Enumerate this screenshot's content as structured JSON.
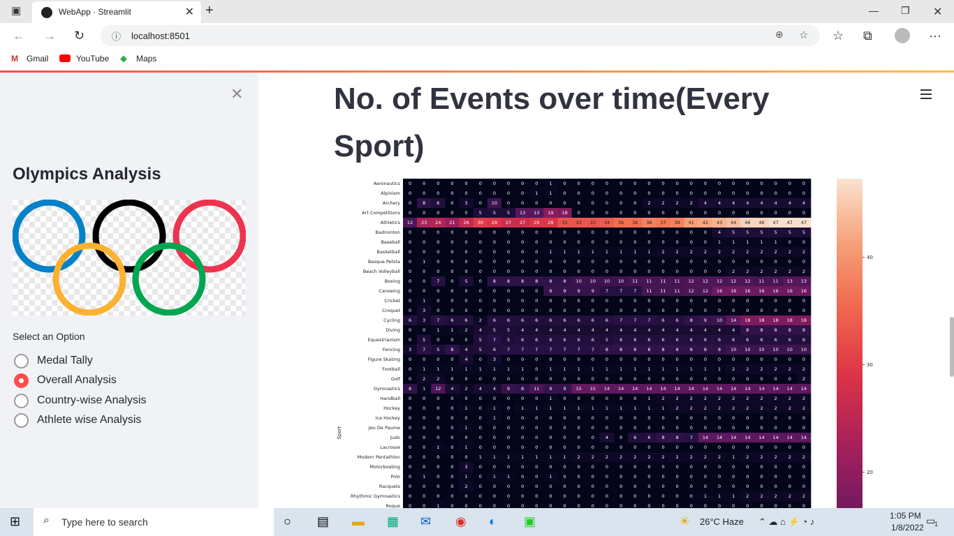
{
  "browser": {
    "tab_title": "WebApp · Streamlit",
    "url": "localhost:8501",
    "bookmarks": [
      "Gmail",
      "YouTube",
      "Maps"
    ]
  },
  "sidebar": {
    "title": "Olympics Analysis",
    "select_label": "Select an Option",
    "options": [
      "Medal Tally",
      "Overall Analysis",
      "Country-wise Analysis",
      "Athlete wise Analysis"
    ],
    "selected": 1
  },
  "main": {
    "title": "No. of Events over time(Every Sport)"
  },
  "chart_data": {
    "type": "heatmap",
    "ylabel": "Sport",
    "colorbar_ticks": [
      20,
      30,
      40
    ],
    "rows": [
      "Aeronautics",
      "Alpinism",
      "Archery",
      "Art Competitions",
      "Athletics",
      "Badminton",
      "Baseball",
      "Basketball",
      "Basque Pelota",
      "Beach Volleyball",
      "Boxing",
      "Canoeing",
      "Cricket",
      "Croquet",
      "Cycling",
      "Diving",
      "Equestrianism",
      "Fencing",
      "Figure Skating",
      "Football",
      "Golf",
      "Gymnastics",
      "Handball",
      "Hockey",
      "Ice Hockey",
      "Jeu De Paume",
      "Judo",
      "Lacrosse",
      "Modern Pentathlon",
      "Motorboating",
      "Polo",
      "Racquets",
      "Rhythmic Gymnastics",
      "Roque"
    ],
    "values": [
      [
        0,
        0,
        0,
        0,
        0,
        0,
        0,
        0,
        0,
        0,
        1,
        0,
        0,
        0,
        0,
        0,
        0,
        0,
        0,
        0,
        0,
        0,
        0,
        0,
        0,
        0,
        0,
        0,
        0
      ],
      [
        0,
        0,
        0,
        0,
        0,
        0,
        0,
        0,
        0,
        1,
        1,
        0,
        0,
        0,
        0,
        0,
        0,
        0,
        0,
        0,
        0,
        0,
        0,
        0,
        0,
        0,
        0,
        0,
        0
      ],
      [
        0,
        8,
        6,
        0,
        3,
        0,
        10,
        0,
        0,
        0,
        0,
        0,
        0,
        0,
        0,
        0,
        0,
        2,
        2,
        2,
        2,
        4,
        4,
        4,
        4,
        4,
        4,
        4,
        4
      ],
      [
        0,
        0,
        0,
        0,
        0,
        5,
        5,
        5,
        13,
        13,
        19,
        18,
        0,
        0,
        0,
        0,
        0,
        0,
        0,
        0,
        0,
        0,
        0,
        0,
        0,
        0,
        0,
        0,
        0
      ],
      [
        12,
        23,
        24,
        21,
        26,
        30,
        29,
        27,
        27,
        29,
        29,
        33,
        33,
        33,
        34,
        36,
        36,
        38,
        37,
        38,
        41,
        42,
        43,
        44,
        46,
        46,
        47,
        47,
        47
      ],
      [
        0,
        0,
        0,
        0,
        0,
        0,
        0,
        0,
        0,
        0,
        0,
        0,
        0,
        0,
        0,
        0,
        0,
        0,
        0,
        0,
        0,
        0,
        4,
        5,
        5,
        5,
        5,
        5,
        5
      ],
      [
        0,
        0,
        0,
        0,
        0,
        0,
        0,
        0,
        0,
        0,
        0,
        0,
        0,
        0,
        0,
        0,
        0,
        0,
        0,
        0,
        0,
        0,
        1,
        1,
        1,
        1,
        1,
        0,
        0
      ],
      [
        0,
        0,
        0,
        0,
        0,
        0,
        0,
        0,
        0,
        0,
        1,
        1,
        1,
        1,
        1,
        1,
        1,
        1,
        2,
        2,
        2,
        2,
        2,
        2,
        2,
        2,
        2,
        2,
        2
      ],
      [
        0,
        1,
        0,
        0,
        0,
        0,
        0,
        0,
        0,
        0,
        0,
        0,
        0,
        0,
        0,
        0,
        0,
        0,
        0,
        0,
        0,
        0,
        0,
        0,
        0,
        0,
        0,
        0,
        0
      ],
      [
        0,
        0,
        0,
        0,
        0,
        0,
        0,
        0,
        0,
        0,
        0,
        0,
        0,
        0,
        0,
        0,
        0,
        0,
        0,
        0,
        0,
        0,
        0,
        2,
        2,
        2,
        2,
        2,
        2
      ],
      [
        0,
        0,
        7,
        0,
        5,
        0,
        8,
        8,
        8,
        8,
        8,
        8,
        10,
        10,
        10,
        10,
        11,
        11,
        11,
        11,
        12,
        12,
        12,
        12,
        12,
        11,
        11,
        13,
        13
      ],
      [
        0,
        0,
        0,
        0,
        0,
        0,
        0,
        0,
        0,
        0,
        9,
        9,
        9,
        9,
        7,
        7,
        7,
        11,
        11,
        11,
        12,
        12,
        16,
        16,
        16,
        16,
        16,
        16,
        16
      ],
      [
        0,
        1,
        0,
        0,
        0,
        0,
        0,
        0,
        0,
        0,
        0,
        0,
        0,
        0,
        0,
        0,
        0,
        0,
        0,
        0,
        0,
        0,
        0,
        0,
        0,
        0,
        0,
        0,
        0
      ],
      [
        0,
        3,
        0,
        0,
        0,
        0,
        0,
        0,
        0,
        0,
        0,
        0,
        0,
        0,
        0,
        0,
        0,
        0,
        0,
        0,
        0,
        0,
        0,
        0,
        0,
        0,
        0,
        0,
        0
      ],
      [
        6,
        3,
        7,
        6,
        6,
        2,
        6,
        6,
        6,
        6,
        6,
        6,
        6,
        6,
        6,
        7,
        7,
        7,
        6,
        6,
        8,
        9,
        10,
        14,
        18,
        18,
        18,
        18,
        18
      ],
      [
        0,
        0,
        1,
        1,
        2,
        4,
        5,
        5,
        4,
        4,
        4,
        4,
        4,
        4,
        4,
        4,
        4,
        4,
        4,
        4,
        4,
        4,
        4,
        4,
        8,
        8,
        8,
        8,
        8
      ],
      [
        0,
        5,
        0,
        0,
        0,
        5,
        7,
        5,
        6,
        6,
        6,
        6,
        6,
        6,
        5,
        6,
        6,
        6,
        6,
        6,
        6,
        6,
        6,
        6,
        6,
        6,
        6,
        6,
        6
      ],
      [
        3,
        7,
        5,
        8,
        4,
        5,
        6,
        7,
        7,
        7,
        7,
        7,
        7,
        7,
        8,
        8,
        8,
        8,
        8,
        8,
        8,
        8,
        8,
        10,
        10,
        10,
        10,
        10,
        10
      ],
      [
        0,
        0,
        0,
        0,
        4,
        0,
        3,
        0,
        0,
        0,
        0,
        0,
        0,
        0,
        0,
        0,
        0,
        0,
        0,
        0,
        0,
        0,
        0,
        0,
        0,
        0,
        0,
        0,
        0
      ],
      [
        0,
        1,
        1,
        1,
        1,
        1,
        1,
        1,
        1,
        0,
        1,
        1,
        1,
        1,
        1,
        1,
        1,
        1,
        1,
        1,
        1,
        1,
        1,
        2,
        2,
        2,
        2,
        2,
        2
      ],
      [
        0,
        2,
        2,
        0,
        0,
        0,
        0,
        0,
        0,
        0,
        0,
        0,
        0,
        0,
        0,
        0,
        0,
        0,
        0,
        0,
        0,
        0,
        0,
        0,
        0,
        0,
        0,
        0,
        2
      ],
      [
        8,
        1,
        12,
        4,
        2,
        4,
        4,
        9,
        8,
        11,
        9,
        9,
        15,
        15,
        14,
        14,
        14,
        14,
        14,
        14,
        14,
        14,
        14,
        14,
        14,
        14,
        14,
        14,
        14
      ],
      [
        0,
        0,
        0,
        0,
        0,
        0,
        0,
        0,
        0,
        0,
        1,
        0,
        0,
        0,
        0,
        0,
        0,
        1,
        2,
        2,
        2,
        2,
        2,
        2,
        2,
        2,
        2,
        2,
        2
      ],
      [
        0,
        0,
        0,
        0,
        1,
        0,
        1,
        0,
        1,
        1,
        1,
        1,
        1,
        1,
        1,
        1,
        1,
        1,
        1,
        2,
        2,
        2,
        2,
        2,
        2,
        2,
        2,
        2,
        2
      ],
      [
        0,
        0,
        0,
        0,
        0,
        0,
        1,
        0,
        0,
        0,
        0,
        0,
        0,
        0,
        0,
        0,
        0,
        0,
        0,
        0,
        0,
        0,
        0,
        0,
        0,
        0,
        0,
        0,
        0
      ],
      [
        0,
        0,
        0,
        0,
        1,
        0,
        0,
        0,
        0,
        0,
        0,
        0,
        0,
        0,
        0,
        0,
        0,
        0,
        0,
        0,
        0,
        0,
        0,
        0,
        0,
        0,
        0,
        0,
        0
      ],
      [
        0,
        0,
        0,
        0,
        0,
        0,
        0,
        0,
        0,
        0,
        0,
        0,
        0,
        0,
        4,
        0,
        6,
        6,
        8,
        8,
        7,
        14,
        14,
        14,
        14,
        14,
        14,
        14,
        14
      ],
      [
        0,
        0,
        1,
        0,
        1,
        0,
        0,
        0,
        0,
        0,
        0,
        0,
        0,
        0,
        0,
        0,
        0,
        0,
        0,
        0,
        0,
        0,
        0,
        0,
        0,
        0,
        0,
        0,
        0
      ],
      [
        0,
        0,
        0,
        0,
        0,
        1,
        1,
        1,
        1,
        1,
        1,
        1,
        2,
        2,
        2,
        2,
        2,
        2,
        2,
        2,
        2,
        2,
        2,
        1,
        2,
        2,
        2,
        2,
        2
      ],
      [
        0,
        0,
        0,
        0,
        3,
        0,
        0,
        0,
        0,
        0,
        0,
        0,
        0,
        0,
        0,
        0,
        0,
        0,
        0,
        0,
        0,
        0,
        0,
        0,
        0,
        0,
        0,
        0,
        0
      ],
      [
        0,
        1,
        0,
        0,
        1,
        0,
        1,
        1,
        0,
        0,
        1,
        0,
        0,
        0,
        0,
        0,
        0,
        0,
        0,
        0,
        0,
        0,
        0,
        0,
        0,
        0,
        0,
        0,
        0
      ],
      [
        0,
        0,
        0,
        0,
        2,
        0,
        0,
        0,
        0,
        0,
        0,
        0,
        0,
        0,
        0,
        0,
        0,
        0,
        0,
        0,
        0,
        0,
        0,
        0,
        0,
        0,
        0,
        0,
        0
      ],
      [
        0,
        0,
        0,
        0,
        0,
        0,
        0,
        0,
        0,
        0,
        0,
        0,
        0,
        0,
        0,
        0,
        0,
        0,
        0,
        0,
        0,
        1,
        1,
        1,
        2,
        2,
        2,
        2,
        2
      ],
      [
        0,
        0,
        1,
        0,
        0,
        0,
        0,
        0,
        0,
        0,
        0,
        0,
        0,
        0,
        0,
        0,
        0,
        0,
        0,
        0,
        0,
        0,
        0,
        0,
        0,
        0,
        0,
        0,
        0
      ]
    ]
  },
  "taskbar": {
    "search_placeholder": "Type here to search",
    "weather": "26°C  Haze",
    "time": "1:05 PM",
    "date": "1/8/2022",
    "notifications": "1"
  }
}
